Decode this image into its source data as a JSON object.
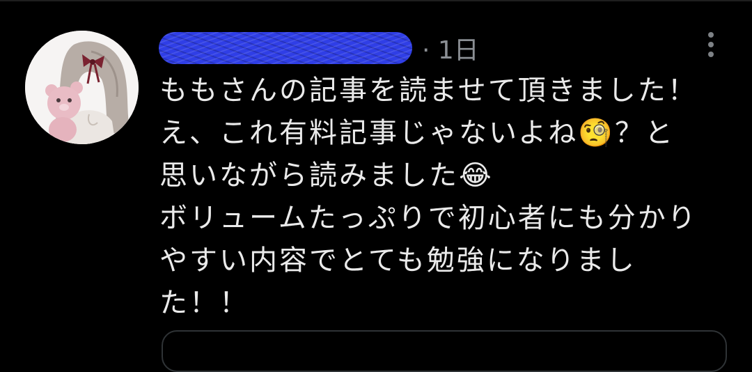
{
  "post": {
    "meta": "· 1日",
    "more_icon": "vertical-ellipsis-icon",
    "text_lines": [
      "ももさんの記事を読ませて頂きました！",
      "え、これ有料記事じゃないよね🧐？と",
      "思いながら読みました😂",
      "ボリュームたっぷりで初心者にも分かり",
      "やすい内容でとても勉強になりまし",
      "た！！"
    ]
  },
  "colors": {
    "background": "#000000",
    "text": "#eaeaea",
    "meta": "#8b8f94",
    "redaction": "#2f3ee6"
  }
}
